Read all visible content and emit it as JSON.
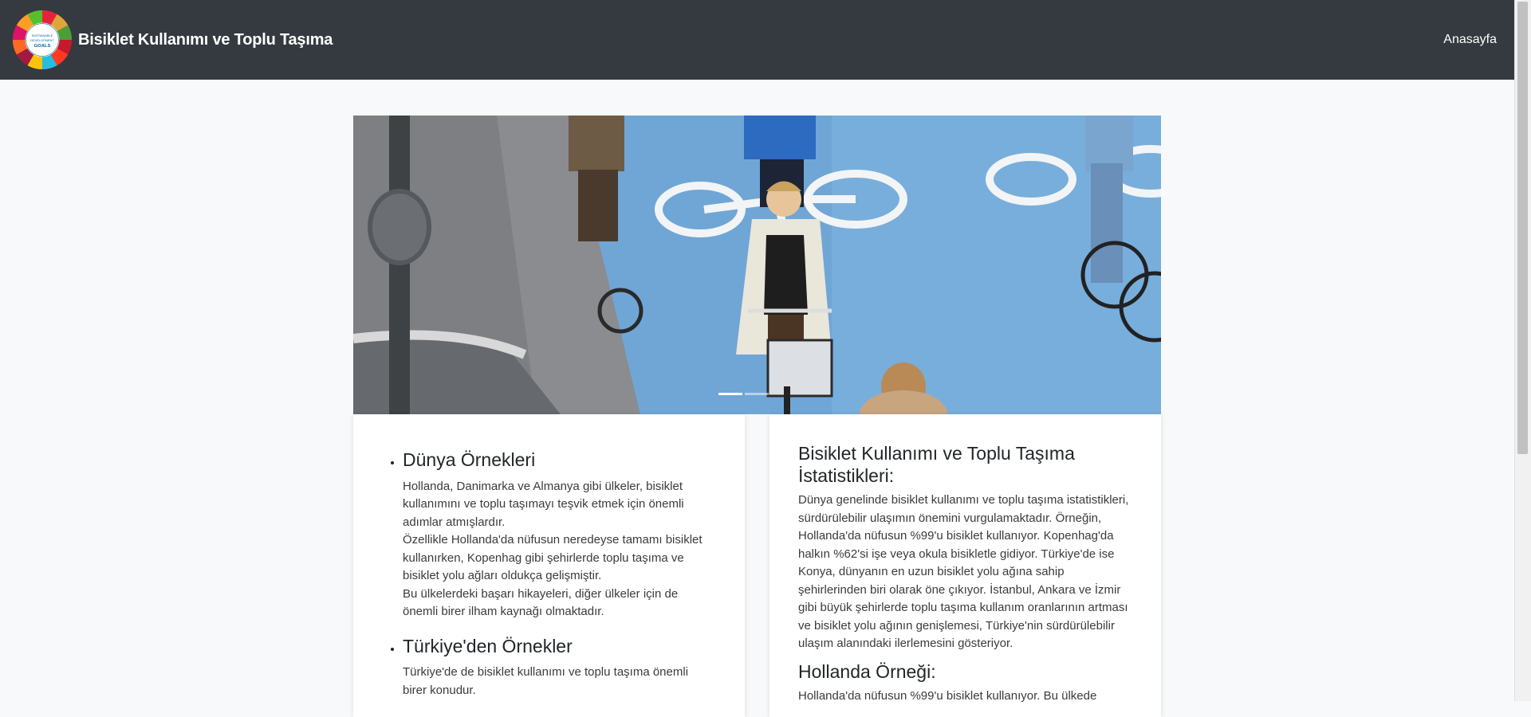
{
  "navbar": {
    "title": "Bisiklet Kullanımı ve Toplu Taşıma",
    "logo_text": "SUSTAINABLE DEVELOPMENT GOALS",
    "links": [
      "Anasayfa"
    ],
    "background": "#343a40"
  },
  "carousel": {
    "image_alt": "Bisiklet yolunda bisiklet süren insanlar",
    "indicators": 2,
    "active_index": 0
  },
  "left_card": {
    "sections": [
      {
        "heading": "Dünya Örnekleri",
        "paragraphs": [
          "Hollanda, Danimarka ve Almanya gibi ülkeler, bisiklet kullanımını ve toplu taşımayı teşvik etmek için önemli adımlar atmışlardır.",
          "Özellikle Hollanda'da nüfusun neredeyse tamamı bisiklet kullanırken, Kopenhag gibi şehirlerde toplu taşıma ve bisiklet yolu ağları oldukça gelişmiştir.",
          "Bu ülkelerdeki başarı hikayeleri, diğer ülkeler için de önemli birer ilham kaynağı olmaktadır."
        ]
      },
      {
        "heading": "Türkiye'den Örnekler",
        "paragraphs": [
          "Türkiye'de de bisiklet kullanımı ve toplu taşıma önemli birer konudur."
        ]
      }
    ]
  },
  "right_card": {
    "heading": "Bisiklet Kullanımı ve Toplu Taşıma İstatistikleri:",
    "paragraph": "Dünya genelinde bisiklet kullanımı ve toplu taşıma istatistikleri, sürdürülebilir ulaşımın önemini vurgulamaktadır. Örneğin, Hollanda'da nüfusun %99'u bisiklet kullanıyor. Kopenhag'da halkın %62'si işe veya okula bisikletle gidiyor. Türkiye'de ise Konya, dünyanın en uzun bisiklet yolu ağına sahip şehirlerinden biri olarak öne çıkıyor. İstanbul, Ankara ve İzmir gibi büyük şehirlerde toplu taşıma kullanım oranlarının artması ve bisiklet yolu ağının genişlemesi, Türkiye'nin sürdürülebilir ulaşım alanındaki ilerlemesini gösteriyor.",
    "subheading": "Hollanda Örneği:",
    "subparagraph": "Hollanda'da nüfusun %99'u bisiklet kullanıyor. Bu ülkede"
  }
}
